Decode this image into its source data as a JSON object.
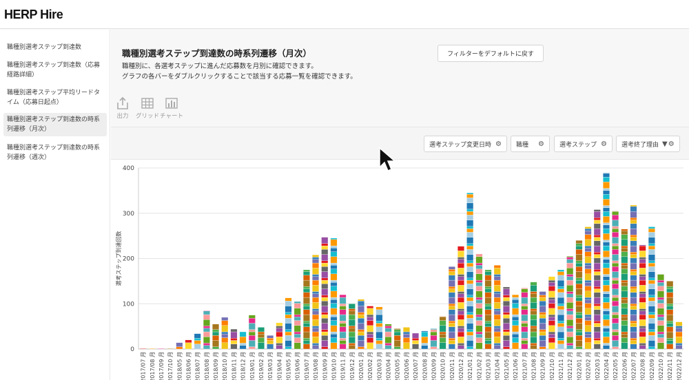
{
  "app": {
    "logo": "HERP Hire"
  },
  "sidebar": {
    "items": [
      {
        "label": "職種別選考ステップ到達数"
      },
      {
        "label": "職種別選考ステップ到達数（応募経路詳細）"
      },
      {
        "label": "職種別選考ステップ平均リードタイム（応募日起点）"
      },
      {
        "label": "職種別選考ステップ到達数の時系列遷移（月次）"
      },
      {
        "label": "職種別選考ステップ到達数の時系列遷移（週次）"
      }
    ]
  },
  "main": {
    "title": "職種別選考ステップ到達数の時系列遷移（月次）",
    "desc_line1": "職種別に、各選考ステップに進んだ応募数を月別に確認できます。",
    "desc_line2": "グラフの各バーをダブルクリックすることで該当する応募一覧を確認できます。",
    "reset_button": "フィルターをデフォルトに戻す"
  },
  "toolbar": {
    "export_label": "出力",
    "grid_label": "グリッド",
    "chart_label": "チャート",
    "export_icon": "upload-icon",
    "grid_icon": "grid-icon",
    "chart_icon": "bar-chart-icon"
  },
  "filters": {
    "date_label": "選考ステップ変更日時",
    "job_label": "職種",
    "step_label": "選考ステップ",
    "reason_label": "選考終了理由",
    "icon": "gear-icon"
  },
  "chart_data": {
    "type": "bar",
    "stacked": true,
    "ylabel": "選考ステップ到達回数",
    "ylim": [
      0,
      400
    ],
    "yticks": [
      0,
      100,
      200,
      300,
      400
    ],
    "tick_suffix": "月",
    "categories": [
      "2017/07",
      "2017/08",
      "2017/09",
      "2017/10",
      "2018/05",
      "2018/06",
      "2018/07",
      "2018/08",
      "2018/09",
      "2018/10",
      "2018/11",
      "2018/12",
      "2019/01",
      "2019/02",
      "2019/03",
      "2019/04",
      "2019/05",
      "2019/06",
      "2019/07",
      "2019/08",
      "2019/09",
      "2019/10",
      "2019/11",
      "2019/12",
      "2020/01",
      "2020/02",
      "2020/03",
      "2020/04",
      "2020/05",
      "2020/06",
      "2020/07",
      "2020/08",
      "2020/09",
      "2020/10",
      "2020/11",
      "2020/12",
      "2021/01",
      "2021/02",
      "2021/03",
      "2021/04",
      "2021/05",
      "2021/06",
      "2021/07",
      "2021/08",
      "2021/09",
      "2021/10",
      "2021/11",
      "2021/12",
      "2022/01",
      "2022/02",
      "2022/03",
      "2022/04",
      "2022/05",
      "2022/06",
      "2022/07",
      "2022/08",
      "2022/09",
      "2022/10",
      "2022/11",
      "2022/12"
    ],
    "totals": [
      1,
      1,
      1,
      1,
      14,
      20,
      34,
      85,
      55,
      70,
      44,
      38,
      75,
      48,
      30,
      58,
      113,
      105,
      175,
      208,
      247,
      245,
      120,
      100,
      110,
      95,
      93,
      55,
      45,
      48,
      35,
      40,
      45,
      72,
      182,
      227,
      345,
      210,
      175,
      185,
      137,
      120,
      135,
      148,
      127,
      160,
      175,
      205,
      240,
      270,
      308,
      390,
      305,
      265,
      318,
      230,
      270,
      165,
      150,
      60
    ],
    "colors": [
      "#e41a1c",
      "#4dafb6",
      "#377eb8",
      "#ff9900",
      "#4daf4a",
      "#984ea3",
      "#e7298a",
      "#f0c419",
      "#17becf",
      "#a6761d",
      "#666666",
      "#66a61e",
      "#ff7f00",
      "#1f78b4",
      "#d95f02",
      "#ffd92f",
      "#fb9a99",
      "#7570b3",
      "#a6cee3",
      "#1b9e77"
    ],
    "grid": true
  }
}
